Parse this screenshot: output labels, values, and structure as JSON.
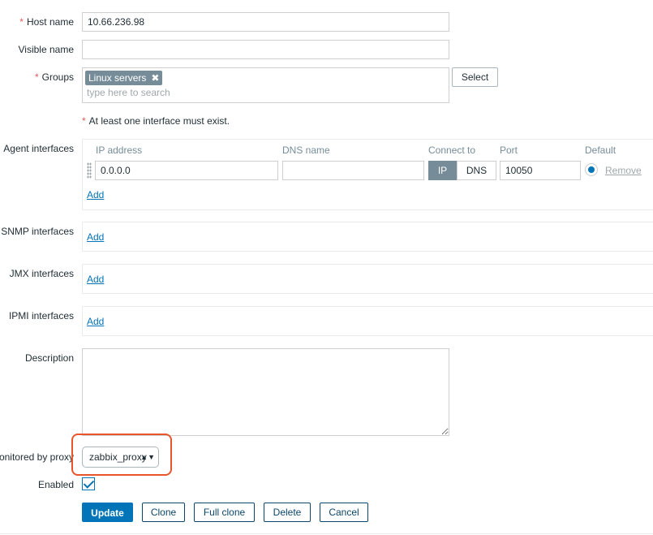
{
  "fields": {
    "host_name": {
      "label": "Host name",
      "required_mark": "*",
      "value": "10.66.236.98"
    },
    "visible_name": {
      "label": "Visible name",
      "value": ""
    },
    "groups": {
      "label": "Groups",
      "required_mark": "*",
      "chips": [
        "Linux servers"
      ],
      "chip_remove": "✖",
      "search_placeholder": "type here to search",
      "select_label": "Select"
    }
  },
  "interface_notice": {
    "mark": "*",
    "text": "At least one interface must exist."
  },
  "agent_interfaces": {
    "label": "Agent interfaces",
    "columns": {
      "ip": "IP address",
      "dns": "DNS name",
      "connect_to": "Connect to",
      "port": "Port",
      "default": "Default"
    },
    "row": {
      "ip": "0.0.0.0",
      "dns": "",
      "connect_ip": "IP",
      "connect_dns": "DNS",
      "port": "10050",
      "remove": "Remove"
    },
    "add": "Add"
  },
  "snmp_interfaces": {
    "label": "SNMP interfaces",
    "add": "Add"
  },
  "jmx_interfaces": {
    "label": "JMX interfaces",
    "add": "Add"
  },
  "ipmi_interfaces": {
    "label": "IPMI interfaces",
    "add": "Add"
  },
  "description": {
    "label": "Description",
    "value": ""
  },
  "proxy": {
    "label": "Monitored by proxy",
    "selected": "zabbix_proxy",
    "arrow": "▲▼"
  },
  "enabled": {
    "label": "Enabled",
    "checked": true
  },
  "actions": {
    "update": "Update",
    "clone": "Clone",
    "full_clone": "Full clone",
    "delete": "Delete",
    "cancel": "Cancel"
  },
  "colors": {
    "accent": "#0275b8",
    "required": "#e45959",
    "highlight": "#e8552a",
    "chip": "#768d99"
  }
}
